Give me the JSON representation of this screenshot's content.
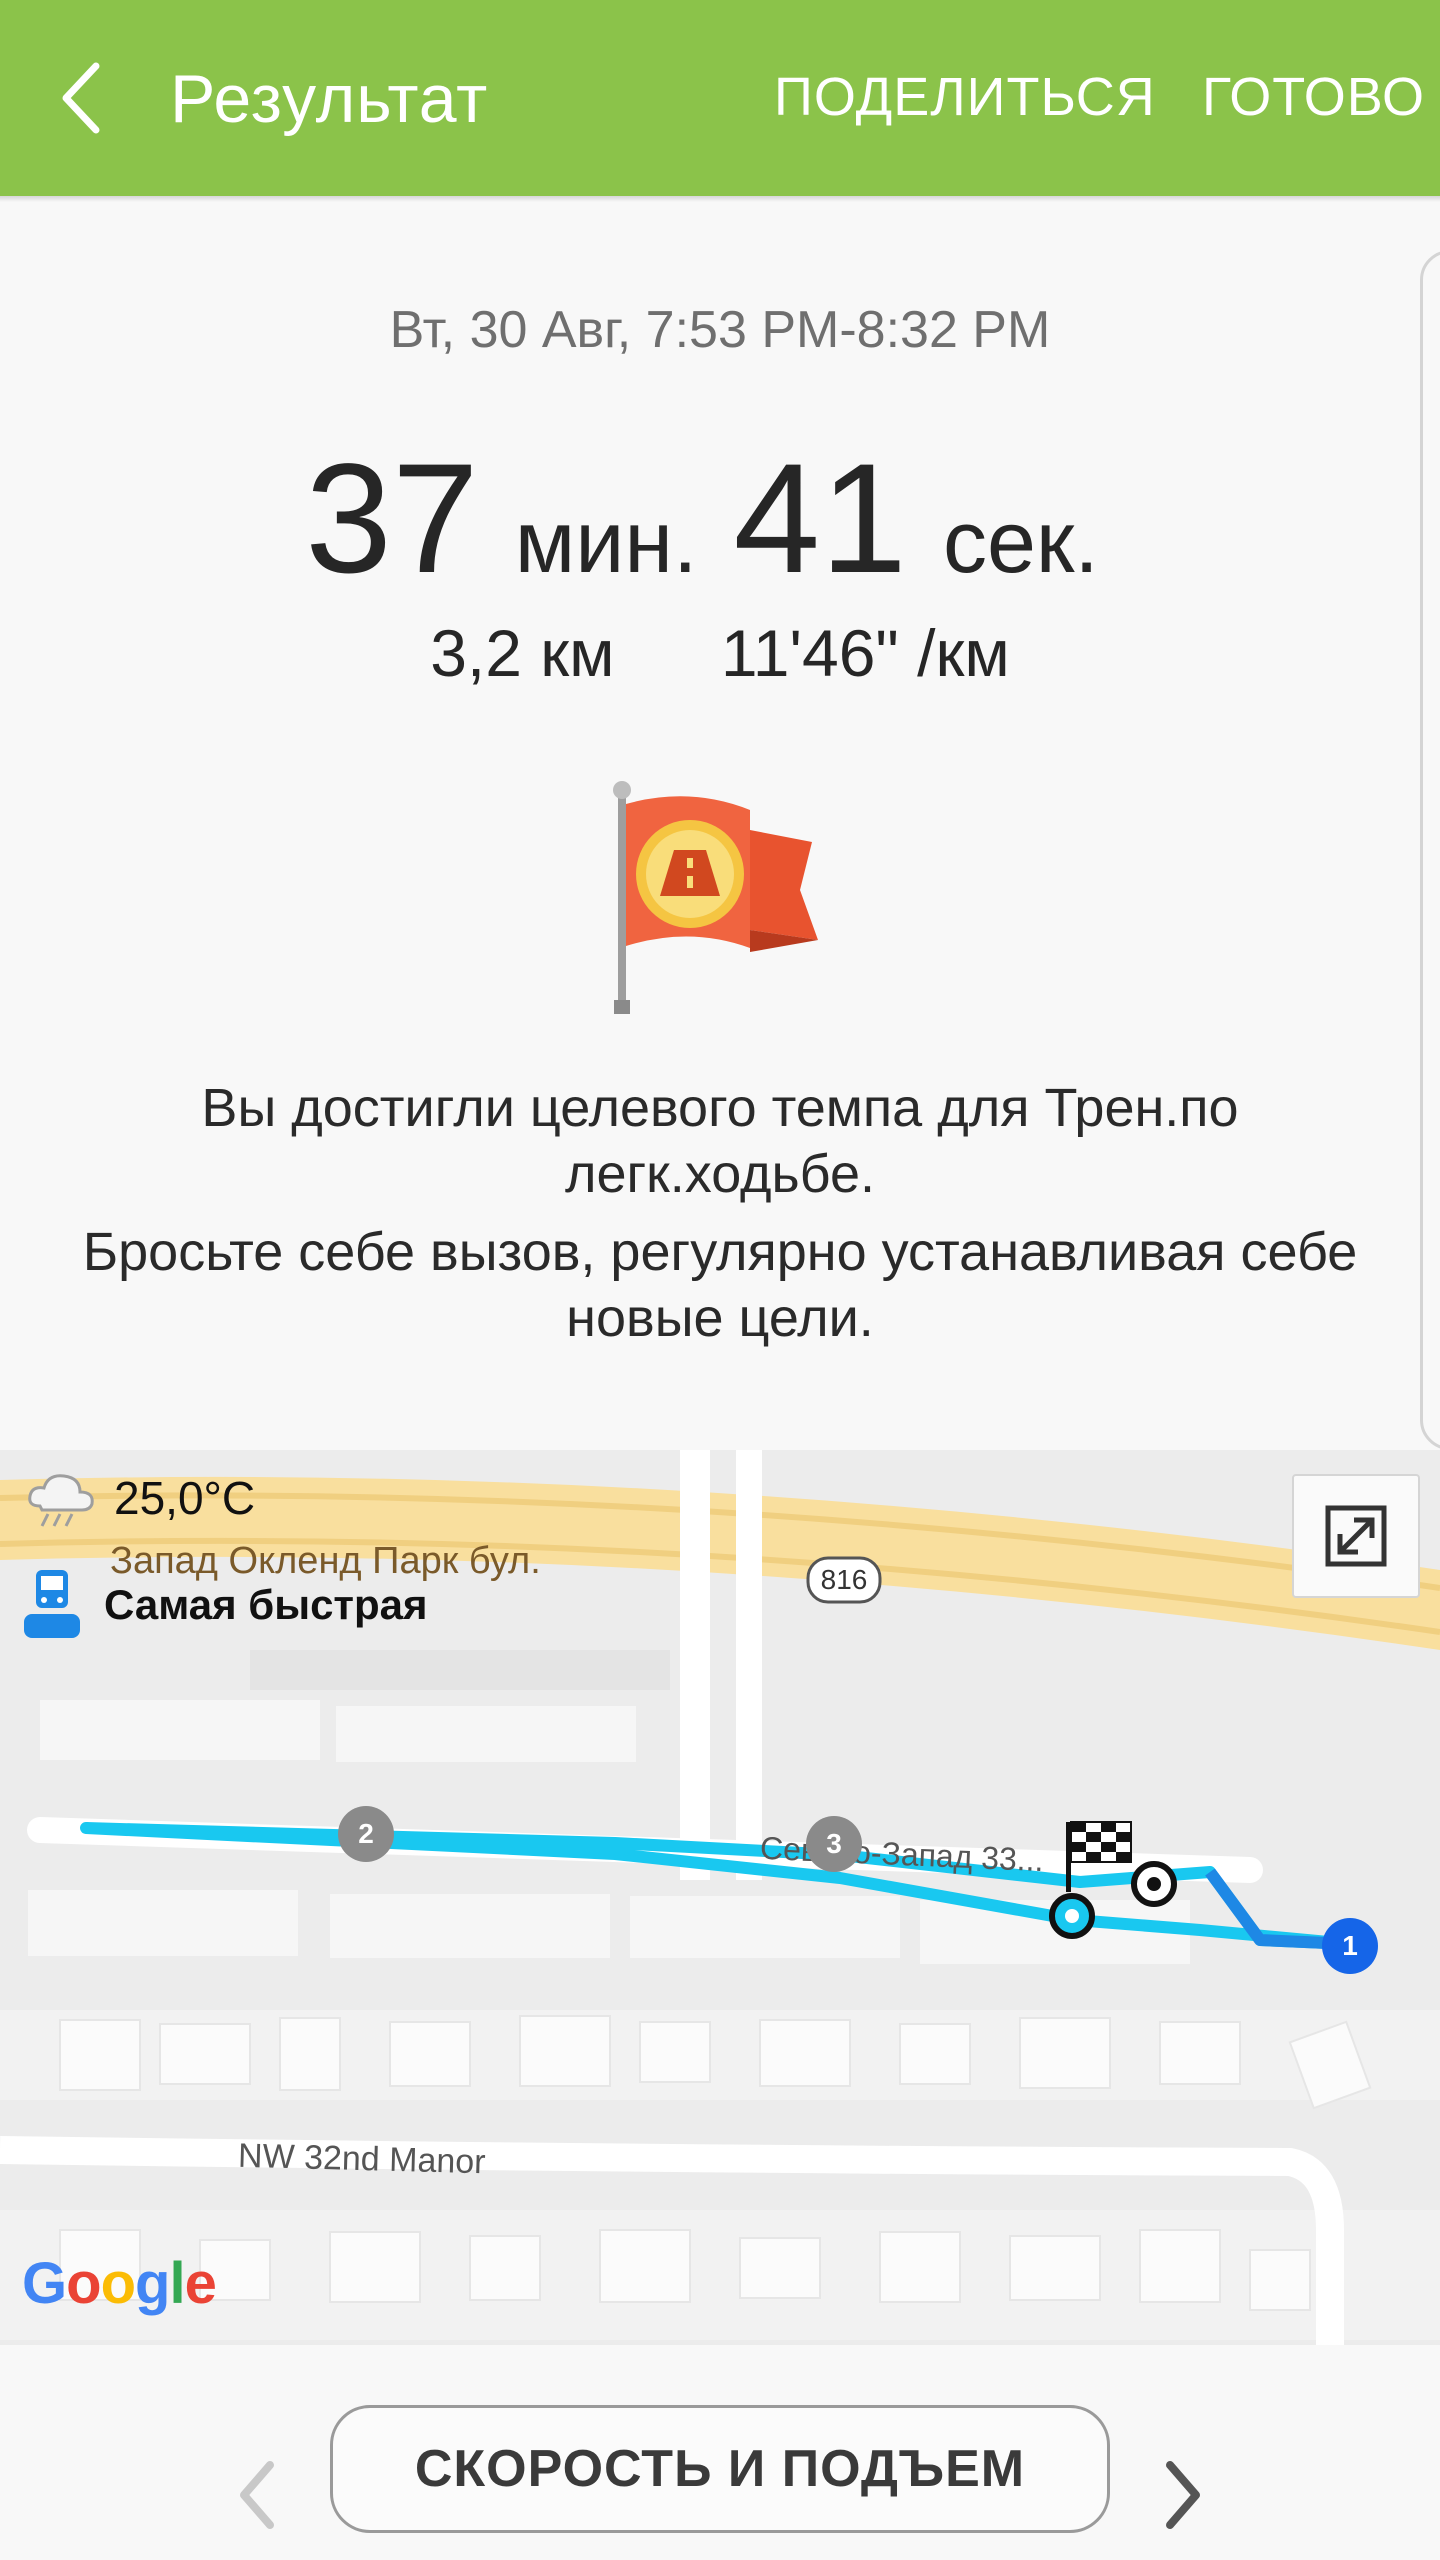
{
  "header": {
    "title": "Результат",
    "share_label": "ПОДЕЛИТЬСЯ",
    "done_label": "ГОТОВО"
  },
  "workout": {
    "datetime": "Вт, 30 Авг, 7:53 PM-8:32 PM",
    "minutes": "37",
    "minutes_unit": "мин.",
    "seconds": "41",
    "seconds_unit": "сек.",
    "distance": "3,2 км",
    "pace": "11'46\" /км"
  },
  "message": {
    "line1": "Вы достигли целевого темпа для Трен.по легк.ходьбе.",
    "line2": "Бросьте себе вызов, регулярно устанавливая себе новые цели."
  },
  "map": {
    "temperature": "25,0°C",
    "street_top": "Запад Окленд Парк бул.",
    "road_shield": "816",
    "transport_label": "Самая быстрая",
    "street_mid": "Северо-Запад 33...",
    "street_bottom": "NW 32nd Manor",
    "logo_text": "Google",
    "markers": [
      "1",
      "2",
      "3"
    ],
    "route_color": "#19c8f0",
    "icons": {
      "weather": "cloud-rain-icon",
      "transport": "bus-icon",
      "expand": "expand-icon",
      "finish": "checkered-flag-icon"
    }
  },
  "footer": {
    "button_label": "СКОРОСТЬ И ПОДЪЕМ"
  },
  "colors": {
    "header": "#8bc34a",
    "accent_route": "#19c8f0",
    "marker_blue": "#1565e8"
  }
}
